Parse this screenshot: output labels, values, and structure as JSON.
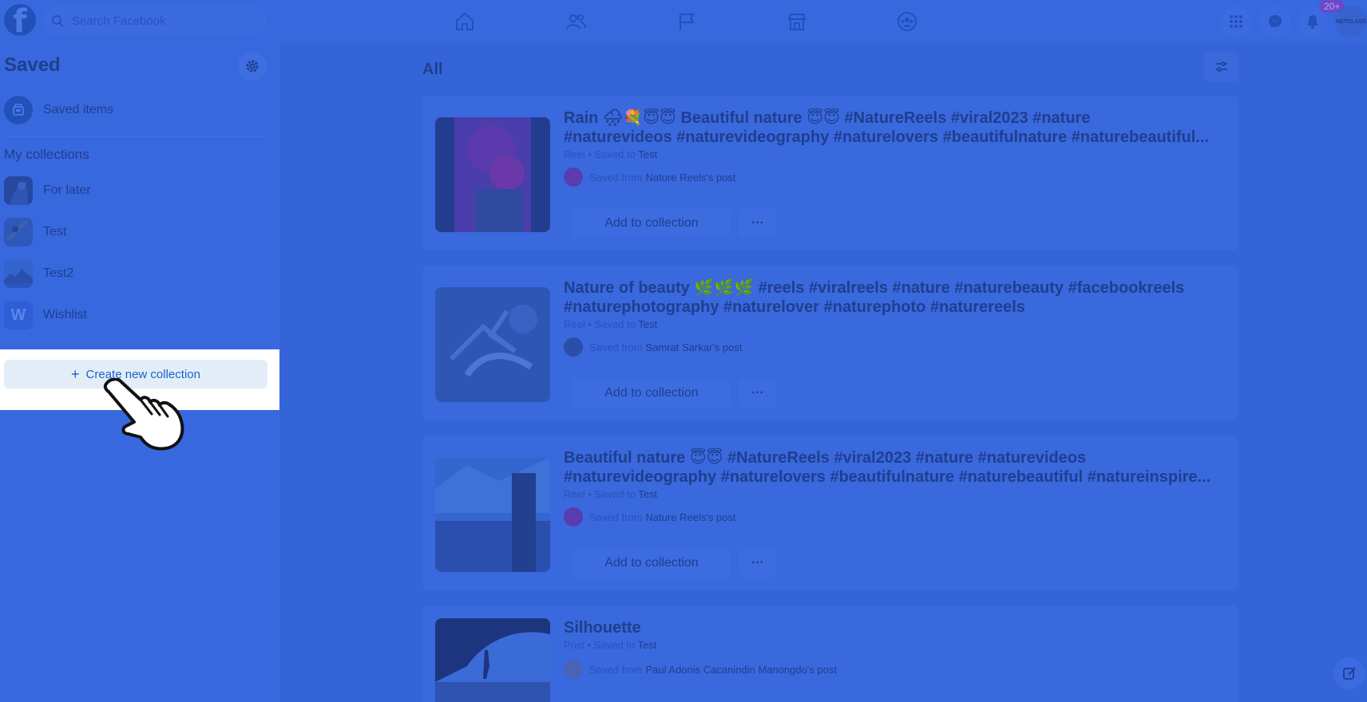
{
  "topbar": {
    "logo_letter": "f",
    "search_placeholder": "Search Facebook",
    "notification_badge": "20+",
    "avatar_text": "NETCLASS"
  },
  "sidebar": {
    "title": "Saved",
    "saved_items_label": "Saved items",
    "section_title": "My collections",
    "collections": [
      {
        "label": "For later"
      },
      {
        "label": "Test"
      },
      {
        "label": "Test2"
      },
      {
        "label": "Wishlist",
        "icon_letter": "W"
      }
    ],
    "create_label": "Create new collection",
    "create_plus": "+"
  },
  "main": {
    "title": "All",
    "add_label": "Add to collection",
    "more_label": "···",
    "saved_from_prefix": "Saved from",
    "cards": [
      {
        "title_line1": "Rain 🌧💐😇😇 Beautiful nature 😇😇 #NatureReels #viral2023 #nature",
        "title_line2": "#naturevideos #naturevideography #naturelovers #beautifulnature #naturebeautiful...",
        "type": "Reel",
        "saved_to_prefix": "• Saved to",
        "collection": "Test",
        "source": "Nature Reels's post"
      },
      {
        "title_line1": "Nature of beauty 🌿🌿🌿 #reels #viralreels #nature #naturebeauty #facebookreels",
        "title_line2": "#naturephotography #naturelover #naturephoto #naturereels",
        "type": "Reel",
        "saved_to_prefix": "• Saved to",
        "collection": "Test",
        "source": "Samrat Sarkar's post"
      },
      {
        "title_line1": "Beautiful nature 😇😇 #NatureReels #viral2023 #nature #naturevideos",
        "title_line2": "#naturevideography #naturelovers #beautifulnature #naturebeautiful #natureinspire...",
        "type": "Reel",
        "saved_to_prefix": "• Saved to",
        "collection": "Test",
        "source": "Nature Reels's post"
      },
      {
        "title_line1": "Silhouette",
        "title_line2": "",
        "type": "Post",
        "saved_to_prefix": "• Saved to",
        "collection": "Test",
        "source": "Paul Adonis Cacanindin Manongdo's post"
      }
    ]
  },
  "colors": {
    "overlay": "#3564d8",
    "text_dark": "#1f3f8e",
    "highlight": "#ffffff",
    "create_button_bg": "#e3edf8",
    "create_button_text": "#1764c8"
  }
}
